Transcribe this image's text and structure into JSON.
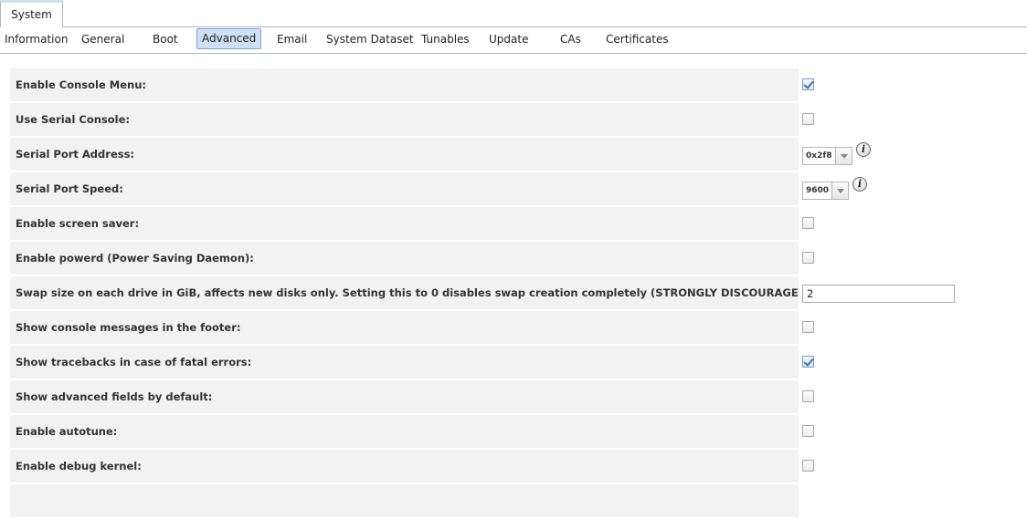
{
  "top_tab": "System",
  "subtabs": [
    "Information",
    "General",
    "Boot",
    "Advanced",
    "Email",
    "System Dataset",
    "Tunables",
    "Update",
    "CAs",
    "Certificates"
  ],
  "active_subtab": "Advanced",
  "settings": [
    {
      "label": "Enable Console Menu:",
      "type": "checkbox",
      "checked": true
    },
    {
      "label": "Use Serial Console:",
      "type": "checkbox",
      "checked": false
    },
    {
      "label": "Serial Port Address:",
      "type": "select",
      "value": "0x2f8",
      "info_icon": "info-icon"
    },
    {
      "label": "Serial Port Speed:",
      "type": "select",
      "value": "9600",
      "info_icon": "info-icon"
    },
    {
      "label": "Enable screen saver:",
      "type": "checkbox",
      "checked": false
    },
    {
      "label": "Enable powerd (Power Saving Daemon):",
      "type": "checkbox",
      "checked": false
    },
    {
      "label": "Swap size on each drive in GiB, affects new disks only. Setting this to 0 disables swap creation completely (STRONGLY DISCOURAGED).",
      "type": "text",
      "value": "2"
    },
    {
      "label": "Show console messages in the footer:",
      "type": "checkbox",
      "checked": false
    },
    {
      "label": "Show tracebacks in case of fatal errors:",
      "type": "checkbox",
      "checked": true
    },
    {
      "label": "Show advanced fields by default:",
      "type": "checkbox",
      "checked": false
    },
    {
      "label": "Enable autotune:",
      "type": "checkbox",
      "checked": false
    },
    {
      "label": "Enable debug kernel:",
      "type": "checkbox",
      "checked": false
    }
  ]
}
